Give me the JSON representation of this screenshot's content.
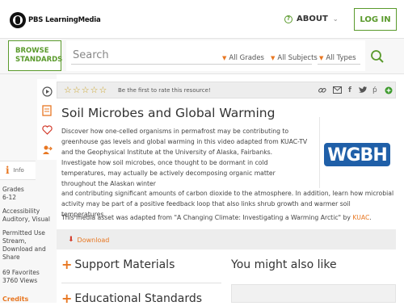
{
  "header": {
    "logo_text": "PBS LearningMedia",
    "about_label": "ABOUT",
    "login_label": "LOG IN"
  },
  "search": {
    "browse_label_line1": "BROWSE",
    "browse_label_line2": "STANDARDS",
    "placeholder": "Search",
    "filters": [
      "All Grades",
      "All Subjects",
      "All Types"
    ]
  },
  "rating": {
    "stars": 0,
    "max_stars": 5,
    "prompt": "Be the first to rate this resource!"
  },
  "share_icons": [
    "link-icon",
    "email-icon",
    "facebook-icon",
    "twitter-icon",
    "pinterest-icon",
    "google-plus-icon"
  ],
  "resource": {
    "title": "Soil Microbes and Global Warming",
    "description_part1": "Discover how one-celled organisms in permafrost may be contributing to greenhouse gas levels and global warming in this video adapted from KUAC-TV and the Geophysical Institute at the University of Alaska, Fairbanks. Investigate how soil microbes, once thought to be dormant in cold temperatures, may actually be actively decomposing organic matter throughout the Alaskan winter",
    "description_part2": "and contributing significant amounts of carbon dioxide to the atmosphere. In addition, learn how microbial activity may be part of a positive feedback loop that also links shrub growth and warmer soil temperatures.",
    "adapted_prefix": "This media asset was adapted from \"A Changing Climate: Investigating a Warming Arctic\" by ",
    "adapted_source": "KUAC",
    "adapted_suffix": ".",
    "publisher_logo": "WGBH",
    "download_label": "Download"
  },
  "sidebar": {
    "info_label": "Info",
    "grades_label": "Grades",
    "grades_value": "6-12",
    "accessibility_label": "Accessibility",
    "accessibility_value": "Auditory, Visual",
    "permitted_label": "Permitted Use",
    "permitted_value_1": "Stream,",
    "permitted_value_2": "Download and",
    "permitted_value_3": "Share",
    "favorites": "69 Favorites",
    "views": "3760 Views",
    "credits_label": "Credits"
  },
  "sections": {
    "support": "Support Materials",
    "standards": "Educational Standards",
    "related": "You might also like"
  },
  "colors": {
    "accent_green": "#5a9a2c",
    "accent_orange": "#e87722",
    "wgbh_blue": "#1f5fa8"
  }
}
